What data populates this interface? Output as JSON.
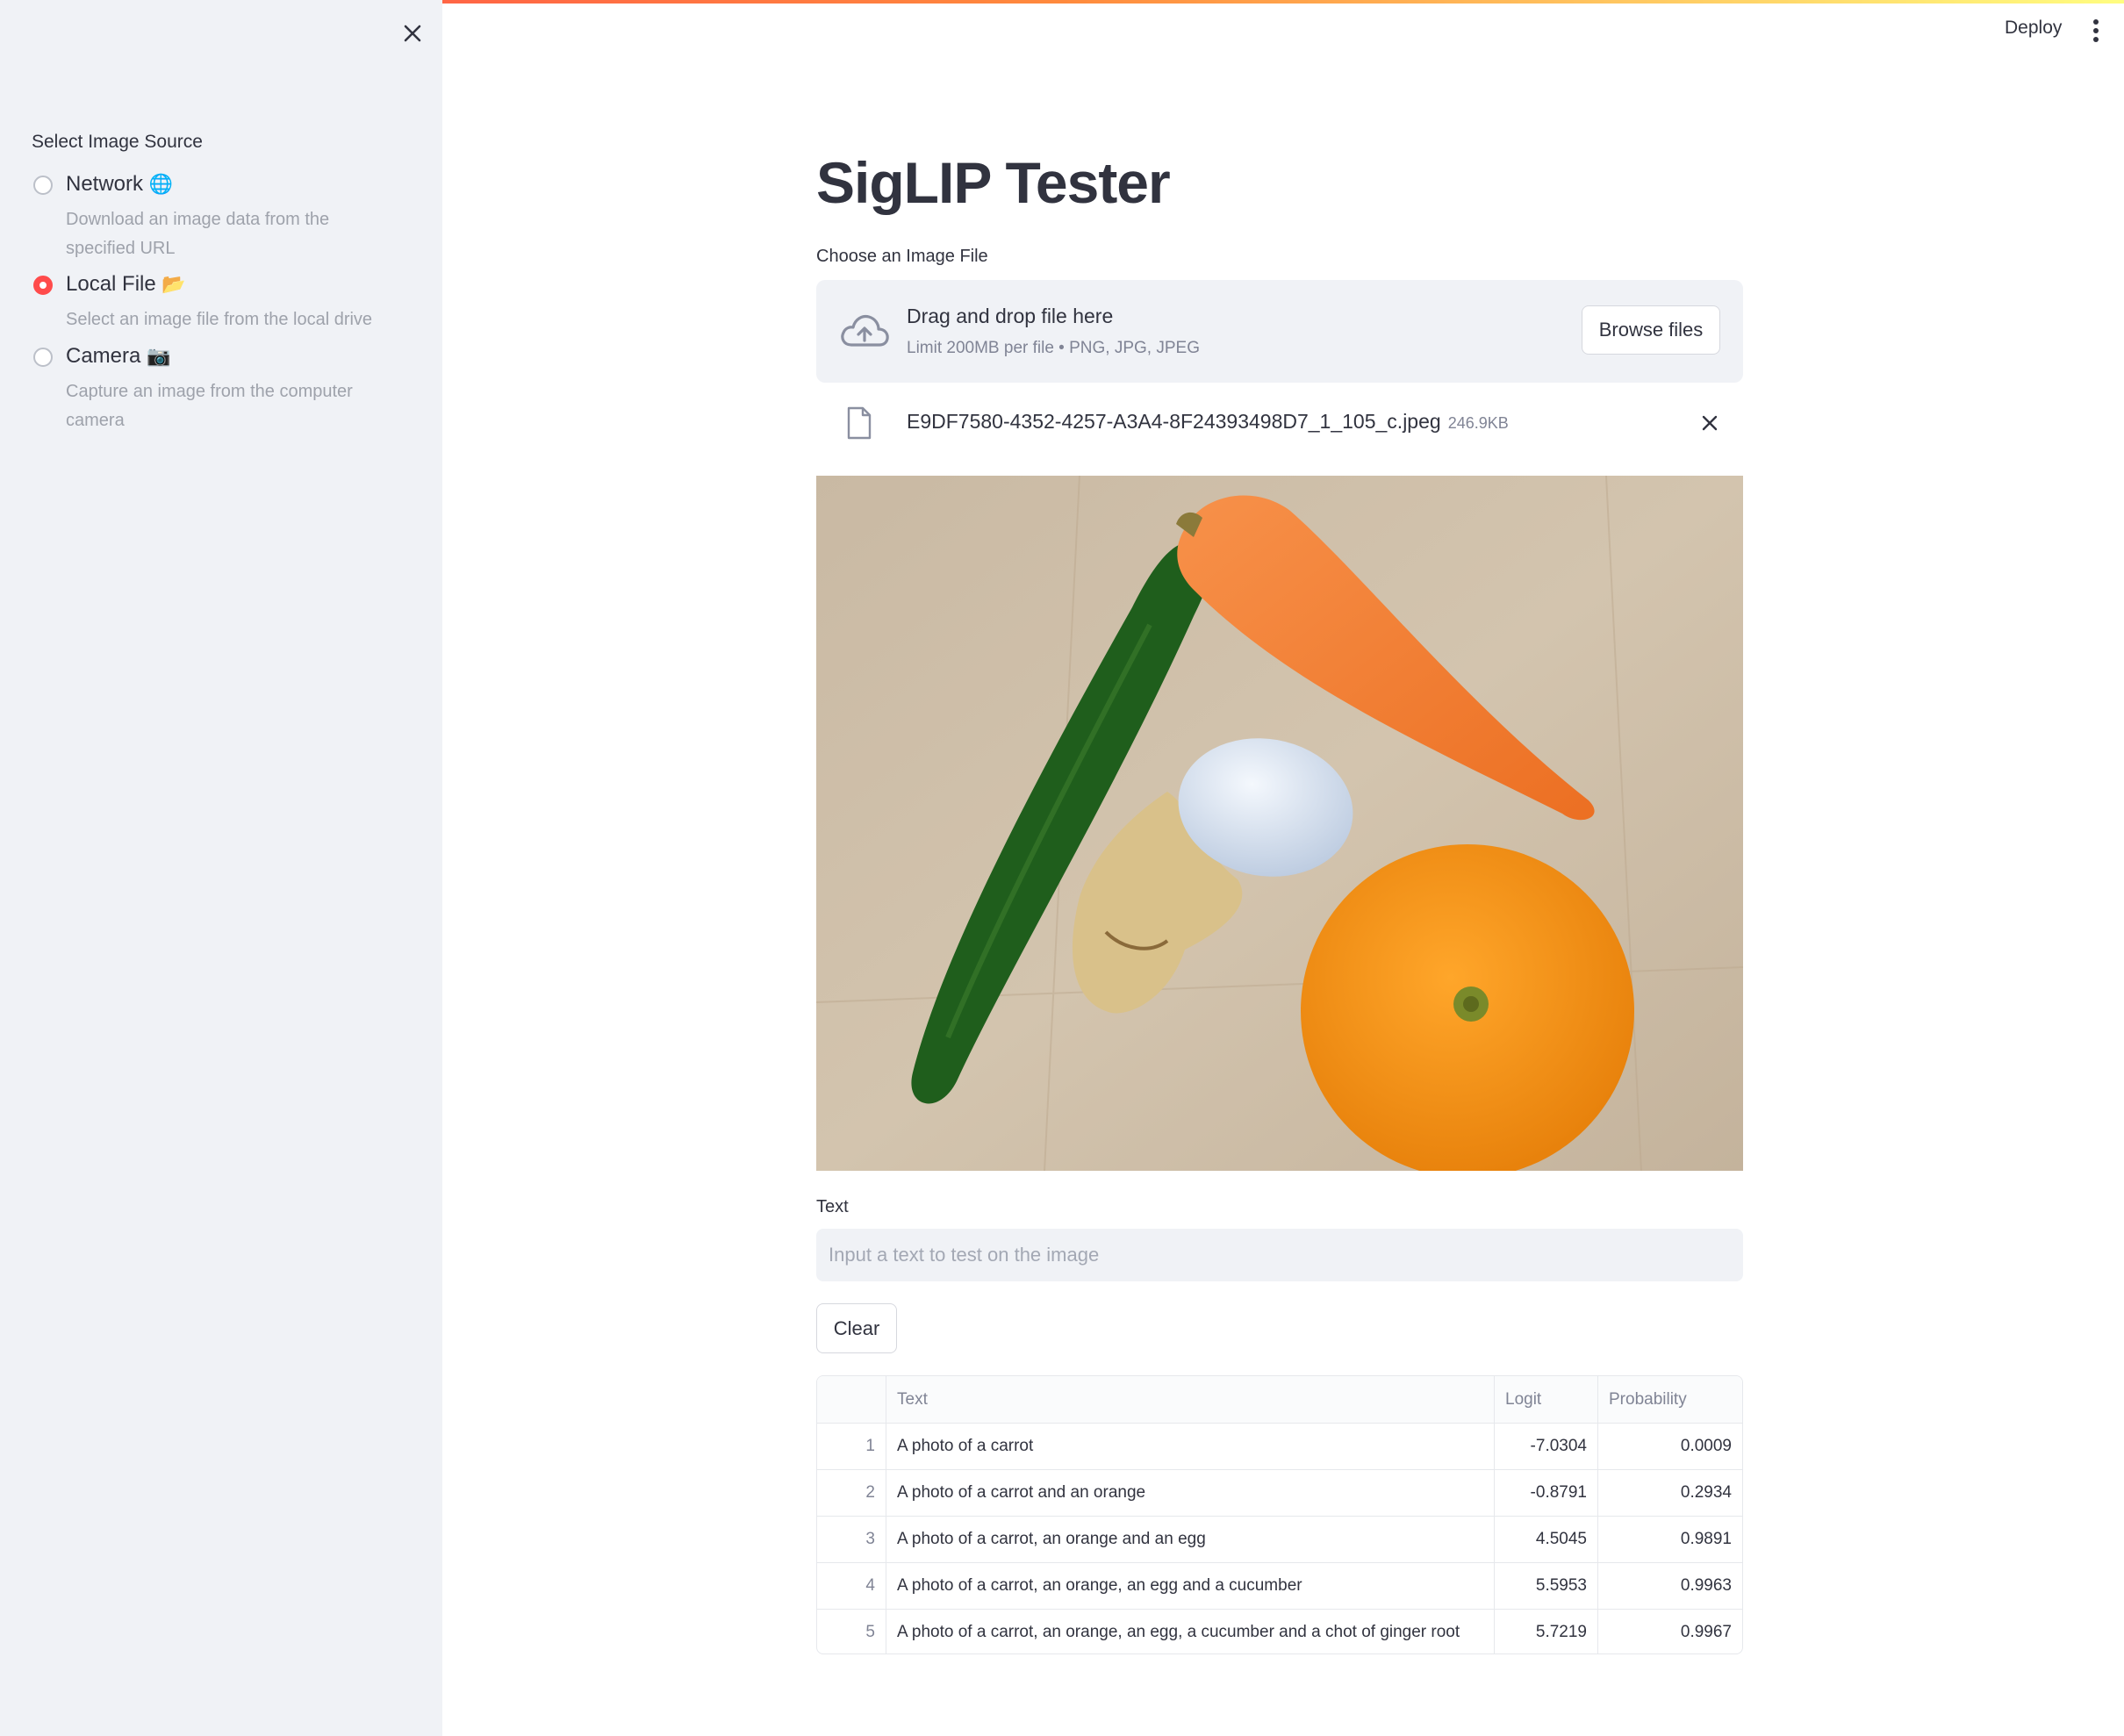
{
  "sidebar": {
    "heading": "Select Image Source",
    "options": [
      {
        "label": "Network",
        "emoji": "🌐",
        "description": "Download an image data from the specified URL",
        "selected": false
      },
      {
        "label": "Local File",
        "emoji": "📂",
        "description": "Select an image file from the local drive",
        "selected": true
      },
      {
        "label": "Camera",
        "emoji": "📷",
        "description": "Capture an image from the computer camera",
        "selected": false
      }
    ]
  },
  "header": {
    "deploy_label": "Deploy"
  },
  "main": {
    "title": "SigLIP Tester",
    "uploader": {
      "label": "Choose an Image File",
      "drop_text": "Drag and drop file here",
      "limit_text": "Limit 200MB per file • PNG, JPG, JPEG",
      "browse_label": "Browse files"
    },
    "file": {
      "name": "E9DF7580-4352-4257-A3A4-8F24393498D7_1_105_c.jpeg",
      "size": "246.9KB"
    },
    "text_label": "Text",
    "text_placeholder": "Input a text to test on the image",
    "clear_label": "Clear",
    "table": {
      "columns": [
        "",
        "Text",
        "Logit",
        "Probability"
      ],
      "rows": [
        {
          "index": "1",
          "text": "A photo of a carrot",
          "logit": "-7.0304",
          "probability": "0.0009"
        },
        {
          "index": "2",
          "text": "A photo of a carrot and an orange",
          "logit": "-0.8791",
          "probability": "0.2934"
        },
        {
          "index": "3",
          "text": "A photo of a carrot, an orange and an egg",
          "logit": "4.5045",
          "probability": "0.9891"
        },
        {
          "index": "4",
          "text": "A photo of a carrot, an orange, an egg and a cucumber",
          "logit": "5.5953",
          "probability": "0.9963"
        },
        {
          "index": "5",
          "text": "A photo of a carrot, an orange, an egg, a cucumber and a chot of ginger root",
          "logit": "5.7219",
          "probability": "0.9967"
        }
      ]
    }
  },
  "colors": {
    "accent": "#ff4b4b",
    "sidebar_bg": "#f0f2f6",
    "text": "#31333f"
  }
}
